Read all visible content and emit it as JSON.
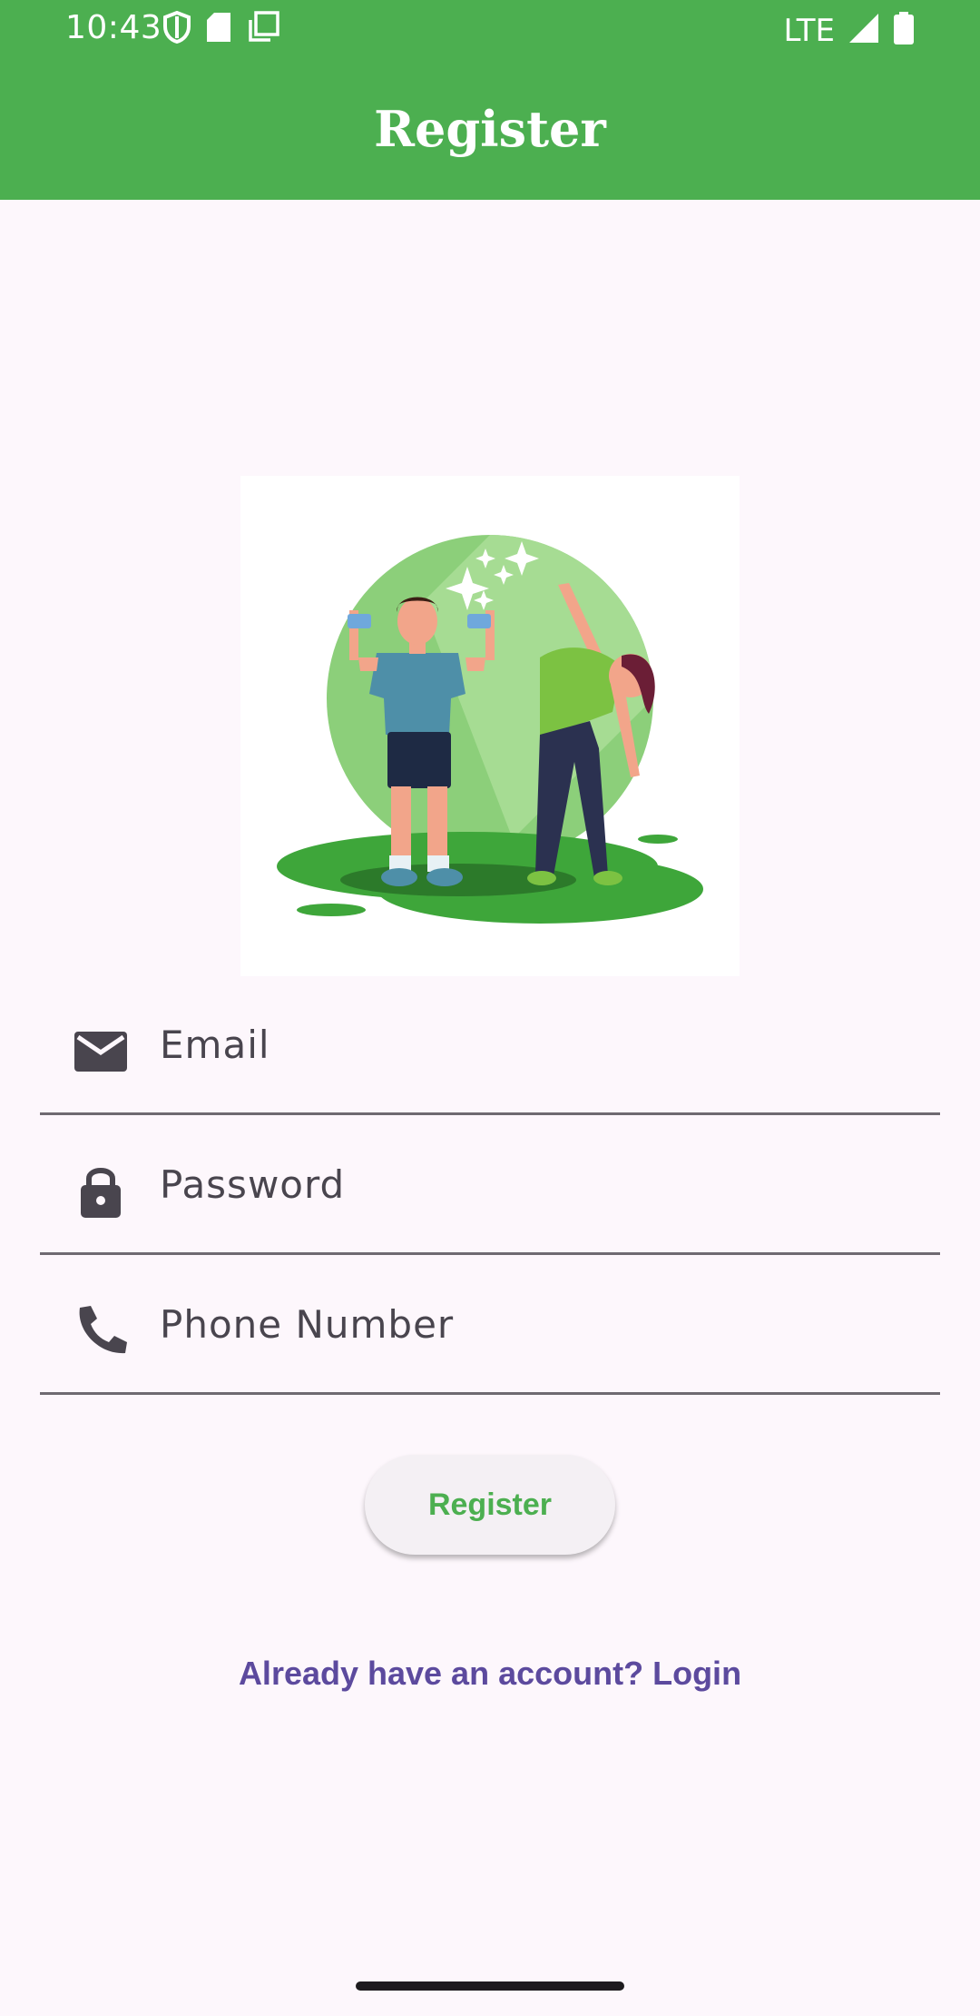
{
  "status_bar": {
    "time": "10:43",
    "network": "LTE",
    "left_icons": [
      "shield-icon",
      "sd-card-icon",
      "copy-icon"
    ],
    "right_icons": [
      "signal-icon",
      "battery-icon"
    ]
  },
  "app_bar": {
    "title": "Register"
  },
  "illustration": {
    "name": "fitness-couple-illustration"
  },
  "form": {
    "email": {
      "placeholder": "Email",
      "value": "",
      "icon": "email-icon"
    },
    "password": {
      "placeholder": "Password",
      "value": "",
      "icon": "lock-icon"
    },
    "phone": {
      "placeholder": "Phone Number",
      "value": "",
      "icon": "phone-icon"
    }
  },
  "register_button": {
    "label": "Register"
  },
  "login_link": {
    "label": "Already have an account? Login"
  },
  "colors": {
    "primary": "#4CAF50",
    "background": "#FDF7FC",
    "link": "#5C4A9E",
    "button_bg": "#F4F0F4"
  }
}
